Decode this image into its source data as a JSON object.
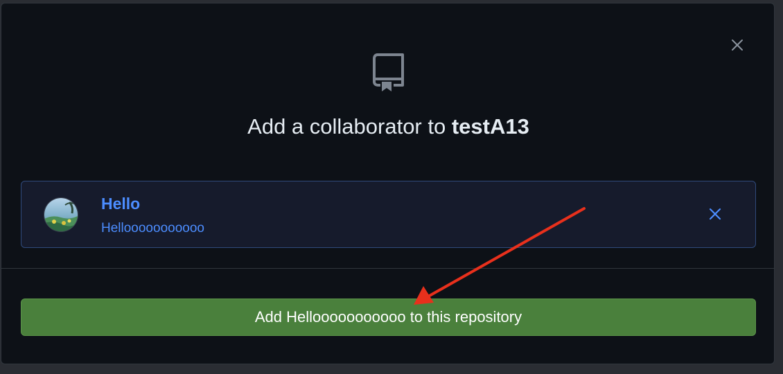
{
  "dialog": {
    "heading_prefix": "Add a collaborator to ",
    "repository_name": "testA13",
    "close_icon": "close-icon",
    "repo_icon": "repo-icon"
  },
  "selected_user": {
    "name": "Hello",
    "login": "Hellooooooooooo",
    "avatar_icon": "avatar-image",
    "remove_icon": "close-icon"
  },
  "action": {
    "add_button_label": "Add Hellooooooooooo to this repository"
  },
  "annotation": {
    "arrow_color": "#e8301c"
  },
  "colors": {
    "background": "#0d1117",
    "accent_blue": "#4c8dff",
    "button_green": "#4a803c",
    "text": "#e6edf3"
  }
}
